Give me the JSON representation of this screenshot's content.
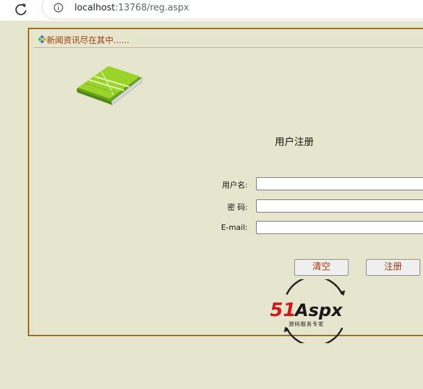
{
  "browser": {
    "url_host": "localhost",
    "url_rest": ":13768/reg.aspx"
  },
  "panel": {
    "header_text": "新闻资讯尽在其中......"
  },
  "form": {
    "title": "用户注册",
    "username_label": "用户名:",
    "password_label": "密 码:",
    "email_label": "E-mail:",
    "username_value": "",
    "password_value": "",
    "email_value": "",
    "clear_button": "清空",
    "register_button": "注册"
  },
  "logo": {
    "brand_number": "51",
    "brand_name": "Aspx",
    "tagline": "源码服务专家"
  },
  "colors": {
    "page_bg": "#e6e6cf",
    "panel_border": "#9c6b21",
    "header_text": "#a33a0b",
    "button_text": "#a33a0b"
  },
  "icons": {
    "reload": "reload-icon",
    "info": "info-icon",
    "header_bullet": "diamond-bullet-icon",
    "book": "book-icon"
  }
}
